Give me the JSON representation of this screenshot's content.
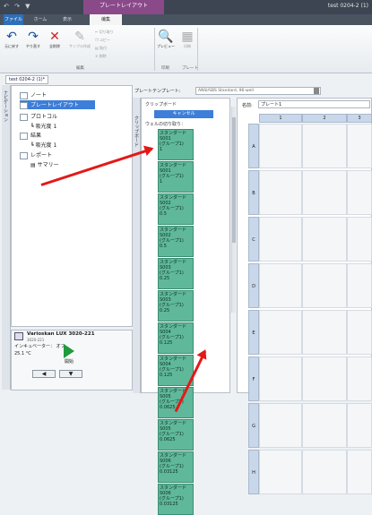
{
  "window": {
    "qat": "↶ ↷ ▼",
    "context_tab": "プレートレイアウト",
    "title": "test 0204-2 (1)"
  },
  "tabs": [
    "ファイル",
    "ホーム",
    "表示",
    "编集"
  ],
  "ribbon": {
    "buttons": [
      "元に戻す",
      "やり直す",
      "全削除",
      "サンプル作成",
      "切り取り",
      "コピー",
      "貼付",
      "削除",
      "プレビュー",
      "印刷"
    ],
    "groups": [
      "編集",
      "印刷",
      "プレート"
    ]
  },
  "doc_tab": "test 0204-2 (1)* ×",
  "left_strip": "ナビゲーション",
  "tree": {
    "items": [
      "ノート",
      "プレートレイアウト",
      "プロトコル",
      "吸光度 1",
      "結果",
      "吸光度 1",
      "レポート",
      "サマリー"
    ]
  },
  "instrument": {
    "name": "Varioskan LUX 3020-221",
    "serial": "3020-221",
    "incubator": "インキュベーター： オフ",
    "temp": "25.1 °C",
    "start": "開始"
  },
  "nav_buttons": [
    "◀",
    "▼"
  ],
  "plate_template_label": "プレートテンプレート:",
  "plate_template_value": "ANSI/SBS Standard, 96-well",
  "clipboard": {
    "strip": "クリップボード",
    "title": "クリップボード",
    "cancel": "キャンセル",
    "hint": "ウェルの切り取り："
  },
  "samples": [
    {
      "l1": "スタンダードS001",
      "l2": "(グループ1)",
      "l3": "1"
    },
    {
      "l1": "スタンダードS001",
      "l2": "(グループ1)",
      "l3": "1"
    },
    {
      "l1": "スタンダードS002",
      "l2": "(グループ1)",
      "l3": "0.5"
    },
    {
      "l1": "スタンダードS002",
      "l2": "(グループ1)",
      "l3": "0.5"
    },
    {
      "l1": "スタンダードS003",
      "l2": "(グループ1)",
      "l3": "0.25"
    },
    {
      "l1": "スタンダードS003",
      "l2": "(グループ1)",
      "l3": "0.25"
    },
    {
      "l1": "スタンダードS004",
      "l2": "(グループ1)",
      "l3": "0.125"
    },
    {
      "l1": "スタンダードS004",
      "l2": "(グループ1)",
      "l3": "0.125"
    },
    {
      "l1": "スタンダードS005",
      "l2": "(グループ1)",
      "l3": "0.0625"
    },
    {
      "l1": "スタンダードS005",
      "l2": "(グループ1)",
      "l3": "0.0625"
    },
    {
      "l1": "スタンダードS006",
      "l2": "(グループ1)",
      "l3": "0.03125"
    },
    {
      "l1": "スタンダードS006",
      "l2": "(グループ1)",
      "l3": "0.03125"
    }
  ],
  "plate": {
    "name_label": "名前:",
    "name_value": "プレート1",
    "cols": [
      "1",
      "2",
      "3"
    ],
    "rows": [
      "A",
      "B",
      "C",
      "D",
      "E",
      "F",
      "G",
      "H"
    ]
  },
  "colors": {
    "accent": "#3d7ed8",
    "sample": "#5fb89a",
    "arrow": "#e41818"
  }
}
